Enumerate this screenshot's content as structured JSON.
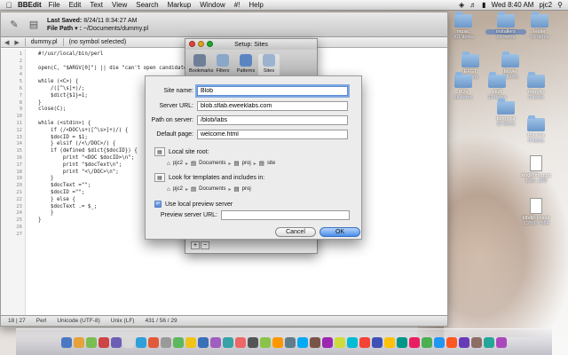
{
  "menubar": {
    "app_name": "BBEdit",
    "menus": [
      "File",
      "Edit",
      "Text",
      "View",
      "Search",
      "Markup",
      "Window",
      "#!",
      "Help"
    ],
    "clock": "Wed 8:40 AM",
    "user": "pjc2"
  },
  "editor": {
    "save_label": "Last Saved:",
    "save_time": "8/24/11 8:34:27 AM",
    "file_path_label": "File Path ▾ :",
    "file_path": "~/Documents/dummy.pl",
    "tab_name": "dummy.pl",
    "symbol_selector": "(no symbol selected)",
    "line_numbers": [
      "1",
      "2",
      "3",
      "4",
      "5",
      "6",
      "7",
      "8",
      "9",
      "10",
      "11",
      "12",
      "13",
      "14",
      "15",
      "16",
      "17",
      "18",
      "19",
      "20",
      "21",
      "22",
      "23",
      "24",
      "25",
      "26",
      "27"
    ],
    "code_lines": [
      "#!/usr/local/bin/perl",
      "",
      "open(C, \"$ARGV[0]\") || die \"can't open candidate d",
      "",
      "while (<C>) {",
      "    /([^\\s]+)/;",
      "    $dict{$1}=1;",
      "}",
      "close(C);",
      "",
      "while (<stdin>) {",
      "    if (/<DOC\\s+([^\\s>]+)/) {",
      "    $docID = $1;",
      "    } elsif (/<\\/DOC>/) {",
      "    if (defined $dict{$docID}) {",
      "        print \"<DOC $docID>\\n\";",
      "        print \"$docText\\n\";",
      "        print \"<\\/DOC>\\n\";",
      "    }",
      "    $docText =\"\";",
      "    $docID =\"\";",
      "    } else {",
      "    $docText .= $_;",
      "    }",
      "}",
      "",
      ""
    ],
    "status": {
      "line": "18",
      "col": "27",
      "language": "Perl",
      "encoding": "Unicode (UTF-8)",
      "line_endings": "Unix (LF)",
      "stats": "431 / 56 / 29"
    }
  },
  "setup_window": {
    "title": "Setup: Sites",
    "tabs": [
      {
        "label": "Bookmarks"
      },
      {
        "label": "Filters"
      },
      {
        "label": "Patterns"
      },
      {
        "label": "Sites"
      }
    ],
    "add_label": "+",
    "remove_label": "−"
  },
  "dialog": {
    "site_name_label": "Site name:",
    "site_name_value": "Blob",
    "server_url_label": "Server URL:",
    "server_url_value": "blob.sflab.eweeklabs.com",
    "path_label": "Path on server:",
    "path_value": "/blob/labs",
    "default_page_label": "Default page:",
    "default_page_value": "welcome.html",
    "local_root_label": "Local site root:",
    "local_root_crumbs": [
      "pjc2",
      "Documents",
      "proj",
      "site"
    ],
    "templates_label": "Look for templates and includes in:",
    "templates_crumbs": [
      "pjc2",
      "Documents",
      "proj"
    ],
    "use_preview_label": "Use local preview server",
    "preview_url_label": "Preview server URL:",
    "preview_url_value": "",
    "cancel_label": "Cancel",
    "ok_label": "OK"
  },
  "desktop_icons": [
    {
      "name": "music",
      "sub": "301 items",
      "kind": "folder"
    },
    {
      "name": "installers",
      "sub": "26 items",
      "kind": "folder",
      "selected": true
    },
    {
      "name": "leafer",
      "sub": "99 items",
      "kind": "folder"
    },
    {
      "name": "EFGT",
      "sub": "6 items",
      "kind": "folder"
    },
    {
      "name": "Movie",
      "sub": "3 items",
      "kind": "folder"
    },
    {
      "name": "M2s",
      "sub": "4k items",
      "kind": "folder"
    },
    {
      "name": "stuff",
      "sub": "19 items",
      "kind": "folder"
    },
    {
      "name": "friendly",
      "sub": "3 items",
      "kind": "folder"
    },
    {
      "name": "funny.ea",
      "sub": "10 items",
      "kind": "folder"
    },
    {
      "name": "hot-ena",
      "sub": "0 items",
      "kind": "folder"
    },
    {
      "name": "xlogPrim.g.pg",
      "sub": "1,66...208",
      "kind": "doc"
    },
    {
      "name": "blbdjit-colors",
      "sub": "1,289 × 564",
      "kind": "doc"
    }
  ]
}
